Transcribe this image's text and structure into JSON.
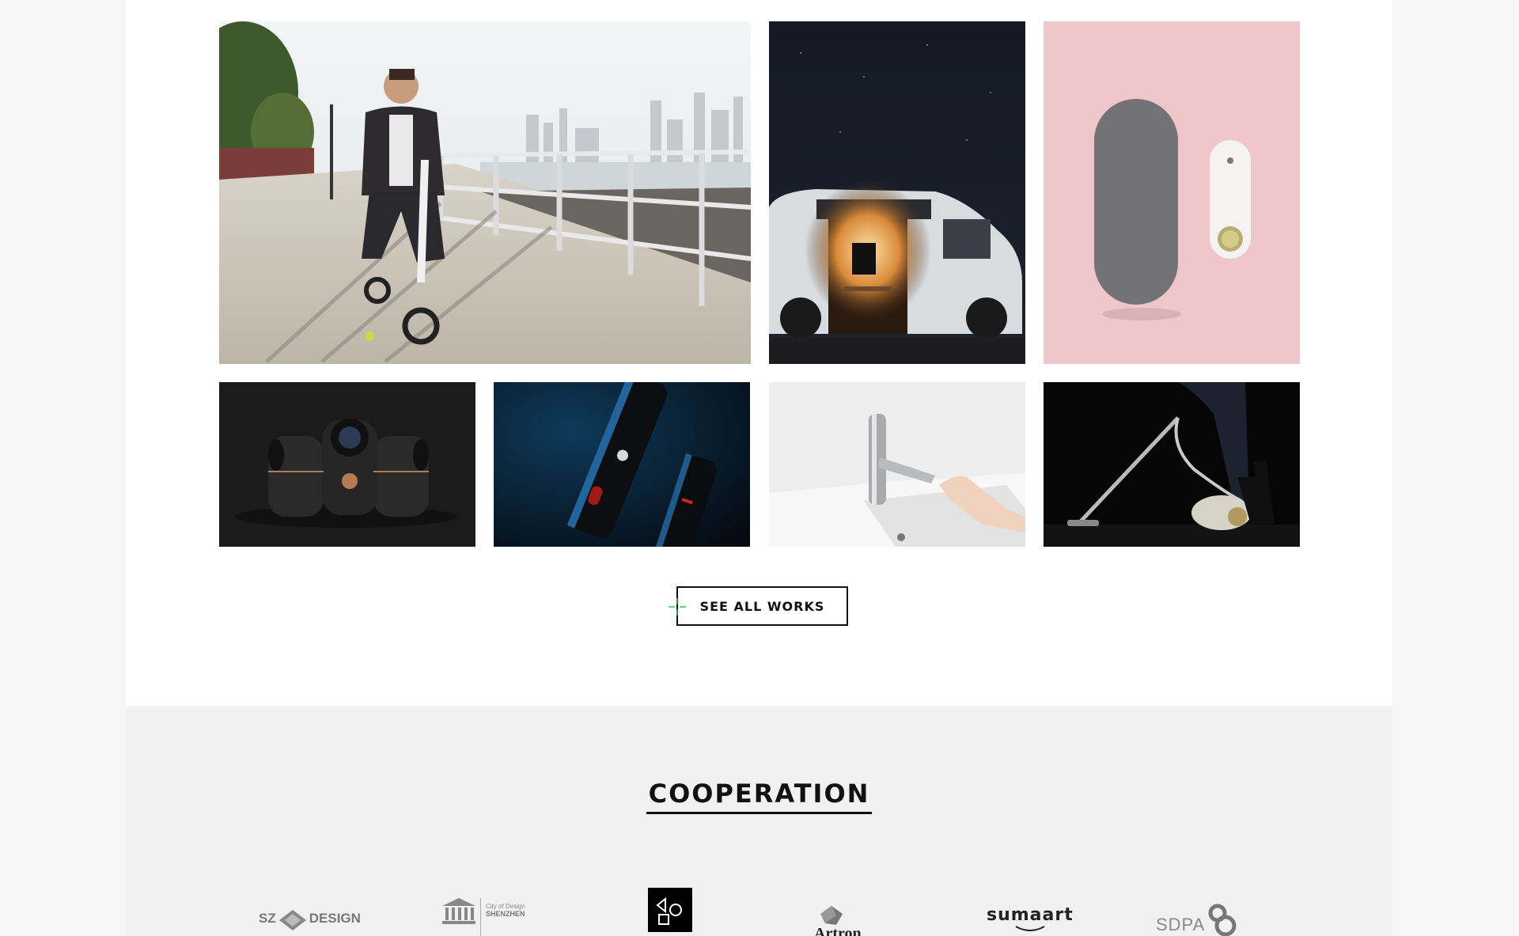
{
  "works": {
    "tiles": [
      {
        "name": "work-electric-scooter"
      },
      {
        "name": "work-camper-van-night"
      },
      {
        "name": "work-pink-speaker"
      },
      {
        "name": "work-vr-camera"
      },
      {
        "name": "work-blue-flashlight"
      },
      {
        "name": "work-touch-faucet"
      },
      {
        "name": "work-vacuum-cleaner"
      }
    ],
    "see_all_label": "SEE ALL WORKS"
  },
  "cooperation": {
    "title": "COOPERATION",
    "logos": {
      "sz_design": {
        "left": "SZ",
        "right": "DESIGN"
      },
      "shenzhen": {
        "line1": "City of Design",
        "line2": "SHENZHEN"
      },
      "artron": {
        "text": "Artron"
      },
      "sumaart": {
        "text": "sumaart"
      },
      "sdpa": {
        "text": "SDPA"
      }
    }
  },
  "colors": {
    "accent_cross": "#27c93f",
    "page_bg": "#f6f6f6",
    "panel_bg": "#ffffff",
    "coop_bg": "#f1f1f1"
  }
}
